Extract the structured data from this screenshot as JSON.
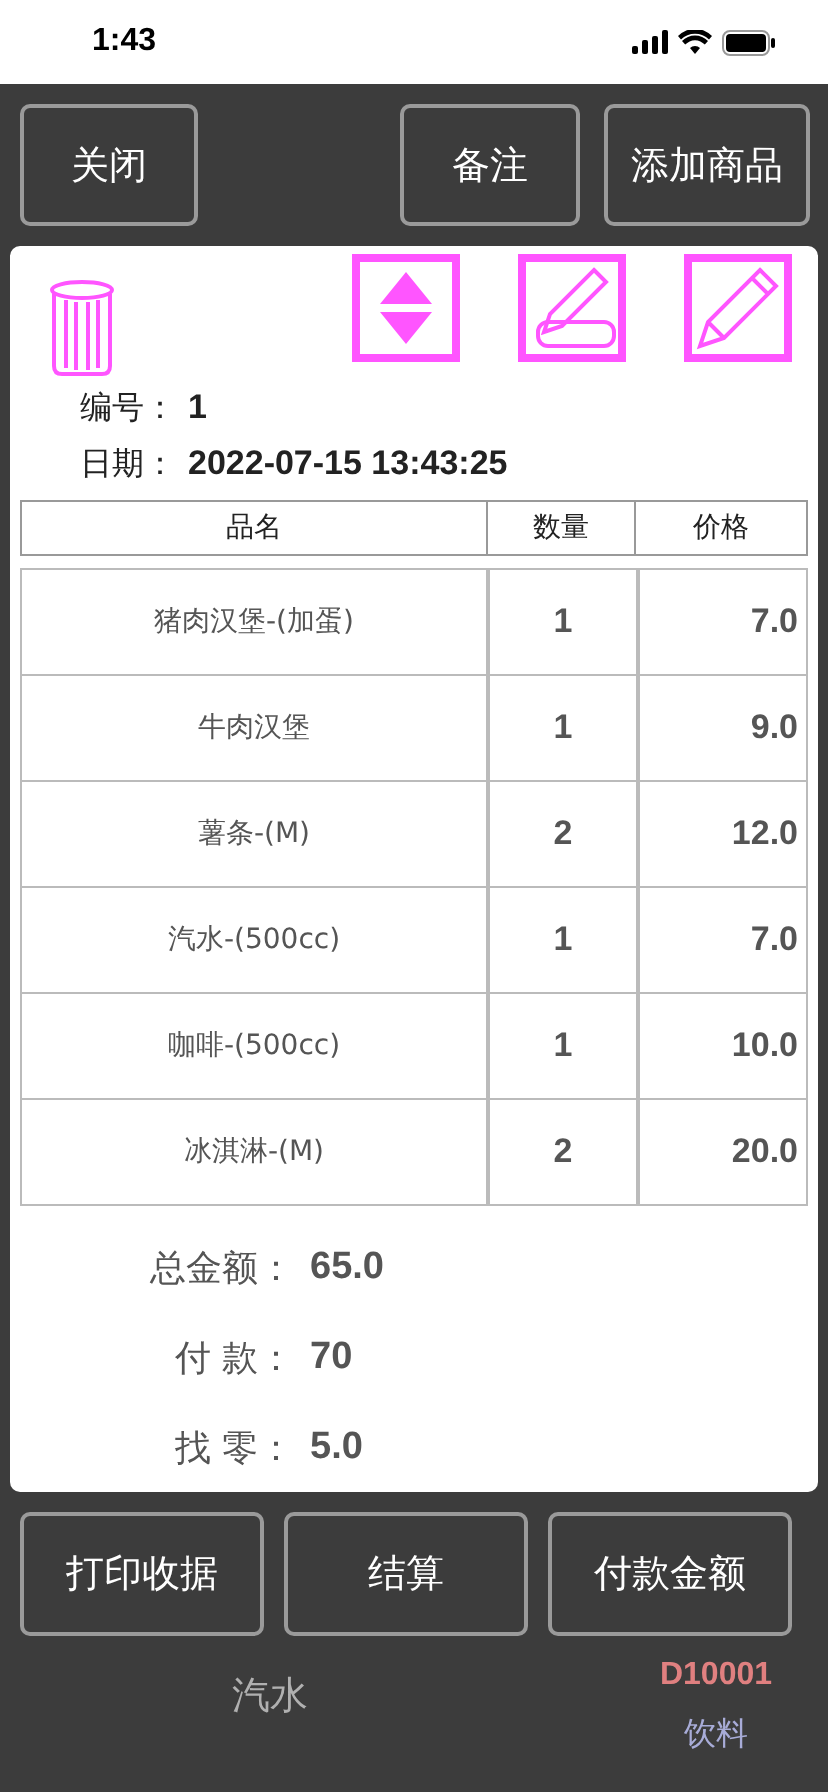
{
  "status_bar": {
    "time": "1:43"
  },
  "background": {
    "item_name": "汽水",
    "code": "D10001",
    "category": "饮料"
  },
  "top_buttons": [
    "关闭",
    "备注",
    "添加商品"
  ],
  "order": {
    "number_label": "编号：",
    "number": "1",
    "date_label": "日期：",
    "date": "2022-07-15 13:43:25"
  },
  "table": {
    "columns": [
      "品名",
      "数量",
      "价格"
    ],
    "rows": [
      {
        "name": "猪肉汉堡-(加蛋)",
        "qty": "1",
        "price": "7.0"
      },
      {
        "name": "牛肉汉堡",
        "qty": "1",
        "price": "9.0"
      },
      {
        "name": "薯条-(M)",
        "qty": "2",
        "price": "12.0"
      },
      {
        "name": "汽水-(500cc)",
        "qty": "1",
        "price": "7.0"
      },
      {
        "name": "咖啡-(500cc)",
        "qty": "1",
        "price": "10.0"
      },
      {
        "name": "冰淇淋-(M)",
        "qty": "2",
        "price": "20.0"
      }
    ]
  },
  "totals": [
    {
      "label": "总金额：",
      "value": "65.0"
    },
    {
      "label": "付 款：",
      "value": "70"
    },
    {
      "label": "找 零：",
      "value": "5.0"
    }
  ],
  "bottom_buttons": [
    "打印收据",
    "结算",
    "付款金额"
  ]
}
